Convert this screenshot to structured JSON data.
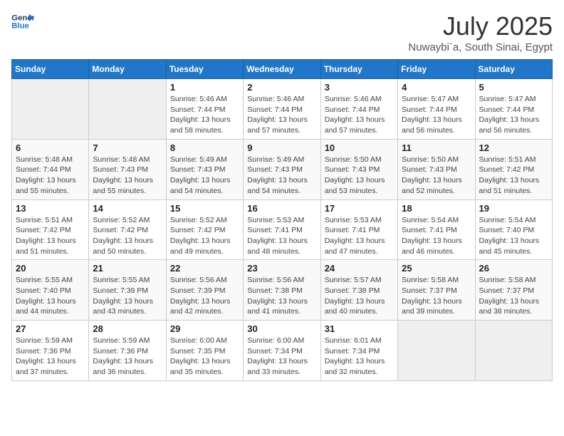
{
  "logo": {
    "line1": "General",
    "line2": "Blue"
  },
  "header": {
    "month": "July 2025",
    "location": "Nuwaybi`a, South Sinai, Egypt"
  },
  "weekdays": [
    "Sunday",
    "Monday",
    "Tuesday",
    "Wednesday",
    "Thursday",
    "Friday",
    "Saturday"
  ],
  "weeks": [
    [
      {
        "day": "",
        "empty": true
      },
      {
        "day": "",
        "empty": true
      },
      {
        "day": "1",
        "sunrise": "5:46 AM",
        "sunset": "7:44 PM",
        "daylight": "13 hours and 58 minutes."
      },
      {
        "day": "2",
        "sunrise": "5:46 AM",
        "sunset": "7:44 PM",
        "daylight": "13 hours and 57 minutes."
      },
      {
        "day": "3",
        "sunrise": "5:46 AM",
        "sunset": "7:44 PM",
        "daylight": "13 hours and 57 minutes."
      },
      {
        "day": "4",
        "sunrise": "5:47 AM",
        "sunset": "7:44 PM",
        "daylight": "13 hours and 56 minutes."
      },
      {
        "day": "5",
        "sunrise": "5:47 AM",
        "sunset": "7:44 PM",
        "daylight": "13 hours and 56 minutes."
      }
    ],
    [
      {
        "day": "6",
        "sunrise": "5:48 AM",
        "sunset": "7:44 PM",
        "daylight": "13 hours and 55 minutes."
      },
      {
        "day": "7",
        "sunrise": "5:48 AM",
        "sunset": "7:43 PM",
        "daylight": "13 hours and 55 minutes."
      },
      {
        "day": "8",
        "sunrise": "5:49 AM",
        "sunset": "7:43 PM",
        "daylight": "13 hours and 54 minutes."
      },
      {
        "day": "9",
        "sunrise": "5:49 AM",
        "sunset": "7:43 PM",
        "daylight": "13 hours and 54 minutes."
      },
      {
        "day": "10",
        "sunrise": "5:50 AM",
        "sunset": "7:43 PM",
        "daylight": "13 hours and 53 minutes."
      },
      {
        "day": "11",
        "sunrise": "5:50 AM",
        "sunset": "7:43 PM",
        "daylight": "13 hours and 52 minutes."
      },
      {
        "day": "12",
        "sunrise": "5:51 AM",
        "sunset": "7:42 PM",
        "daylight": "13 hours and 51 minutes."
      }
    ],
    [
      {
        "day": "13",
        "sunrise": "5:51 AM",
        "sunset": "7:42 PM",
        "daylight": "13 hours and 51 minutes."
      },
      {
        "day": "14",
        "sunrise": "5:52 AM",
        "sunset": "7:42 PM",
        "daylight": "13 hours and 50 minutes."
      },
      {
        "day": "15",
        "sunrise": "5:52 AM",
        "sunset": "7:42 PM",
        "daylight": "13 hours and 49 minutes."
      },
      {
        "day": "16",
        "sunrise": "5:53 AM",
        "sunset": "7:41 PM",
        "daylight": "13 hours and 48 minutes."
      },
      {
        "day": "17",
        "sunrise": "5:53 AM",
        "sunset": "7:41 PM",
        "daylight": "13 hours and 47 minutes."
      },
      {
        "day": "18",
        "sunrise": "5:54 AM",
        "sunset": "7:41 PM",
        "daylight": "13 hours and 46 minutes."
      },
      {
        "day": "19",
        "sunrise": "5:54 AM",
        "sunset": "7:40 PM",
        "daylight": "13 hours and 45 minutes."
      }
    ],
    [
      {
        "day": "20",
        "sunrise": "5:55 AM",
        "sunset": "7:40 PM",
        "daylight": "13 hours and 44 minutes."
      },
      {
        "day": "21",
        "sunrise": "5:55 AM",
        "sunset": "7:39 PM",
        "daylight": "13 hours and 43 minutes."
      },
      {
        "day": "22",
        "sunrise": "5:56 AM",
        "sunset": "7:39 PM",
        "daylight": "13 hours and 42 minutes."
      },
      {
        "day": "23",
        "sunrise": "5:56 AM",
        "sunset": "7:38 PM",
        "daylight": "13 hours and 41 minutes."
      },
      {
        "day": "24",
        "sunrise": "5:57 AM",
        "sunset": "7:38 PM",
        "daylight": "13 hours and 40 minutes."
      },
      {
        "day": "25",
        "sunrise": "5:58 AM",
        "sunset": "7:37 PM",
        "daylight": "13 hours and 39 minutes."
      },
      {
        "day": "26",
        "sunrise": "5:58 AM",
        "sunset": "7:37 PM",
        "daylight": "13 hours and 38 minutes."
      }
    ],
    [
      {
        "day": "27",
        "sunrise": "5:59 AM",
        "sunset": "7:36 PM",
        "daylight": "13 hours and 37 minutes."
      },
      {
        "day": "28",
        "sunrise": "5:59 AM",
        "sunset": "7:36 PM",
        "daylight": "13 hours and 36 minutes."
      },
      {
        "day": "29",
        "sunrise": "6:00 AM",
        "sunset": "7:35 PM",
        "daylight": "13 hours and 35 minutes."
      },
      {
        "day": "30",
        "sunrise": "6:00 AM",
        "sunset": "7:34 PM",
        "daylight": "13 hours and 33 minutes."
      },
      {
        "day": "31",
        "sunrise": "6:01 AM",
        "sunset": "7:34 PM",
        "daylight": "13 hours and 32 minutes."
      },
      {
        "day": "",
        "empty": true
      },
      {
        "day": "",
        "empty": true
      }
    ]
  ]
}
